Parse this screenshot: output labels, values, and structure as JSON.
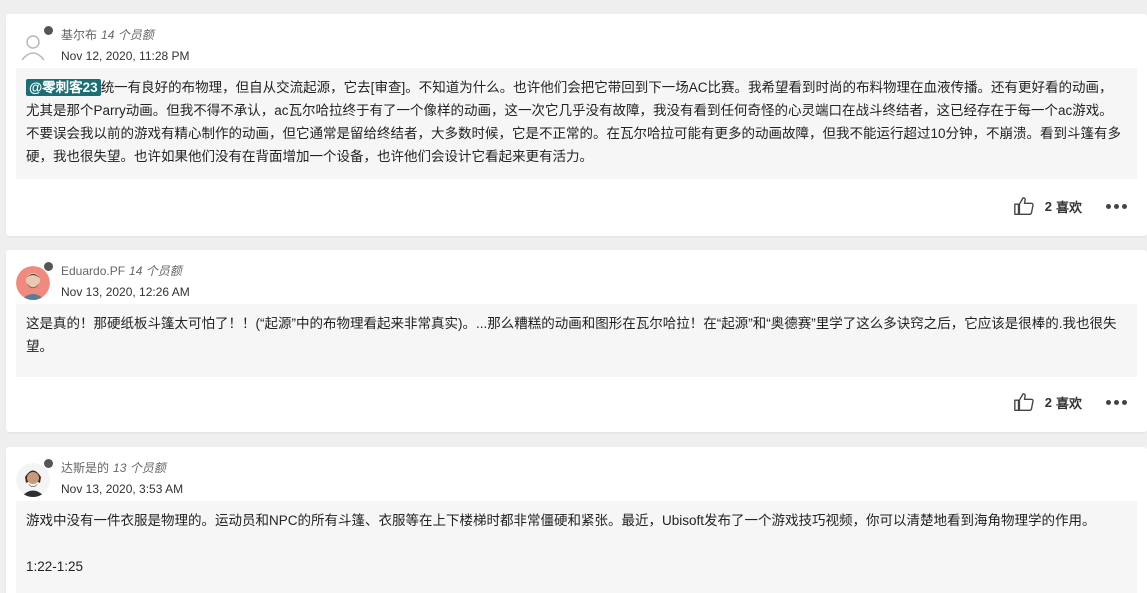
{
  "posts": [
    {
      "author": "基尔布",
      "rank": "14 个员额",
      "date": "Nov 12, 2020, 11:28 PM",
      "mention": "@零刺客23",
      "body": "统一有良好的布物理，但自从交流起源，它去[审查]。不知道为什么。也许他们会把它带回到下一场AC比赛。我希望看到时尚的布料物理在血液传播。还有更好看的动画，尤其是那个Parry动画。但我不得不承认，ac瓦尔哈拉终于有了一个像样的动画，这一次它几乎没有故障，我没有看到任何奇怪的心灵端口在战斗终结者，这已经存在于每一个ac游戏。不要误会我以前的游戏有精心制作的动画，但它通常是留给终结者，大多数时候，它是不正常的。在瓦尔哈拉可能有更多的动画故障，但我不能运行超过10分钟，不崩溃。看到斗篷有多硬，我也很失望。也许如果他们没有在背面增加一个设备，也许他们会设计它看起来更有活力。",
      "likes": "2",
      "like_label": "喜欢",
      "avatar_icon": "default-user-icon"
    },
    {
      "author": "Eduardo.PF",
      "rank": "14 个员额",
      "date": "Nov 13, 2020, 12:26 AM",
      "body": "这是真的！那硬纸板斗篷太可怕了！！(“起源”中的布物理看起来非常真实)。...那么糟糕的动画和图形在瓦尔哈拉！在“起源”和“奥德赛”里学了这么多诀窍之后，它应该是很棒的.我也很失望。",
      "likes": "2",
      "like_label": "喜欢",
      "avatar_icon": "eduardo-avatar"
    },
    {
      "author": "达斯是的",
      "rank": "13 个员额",
      "date": "Nov 13, 2020, 3:53 AM",
      "body": "游戏中没有一件衣服是物理的。运动员和NPC的所有斗篷、衣服等在上下楼梯时都非常僵硬和紧张。最近，Ubisoft发布了一个游戏技巧视频，你可以清楚地看到海角物理学的作用。",
      "body_extra": "1:22-1:25",
      "avatar_icon": "dasi-avatar"
    }
  ],
  "colors": {
    "mention_bg": "#1b6f74",
    "card_bg": "#ffffff",
    "body_bg": "#f6f6f6",
    "page_bg": "#efefef"
  }
}
